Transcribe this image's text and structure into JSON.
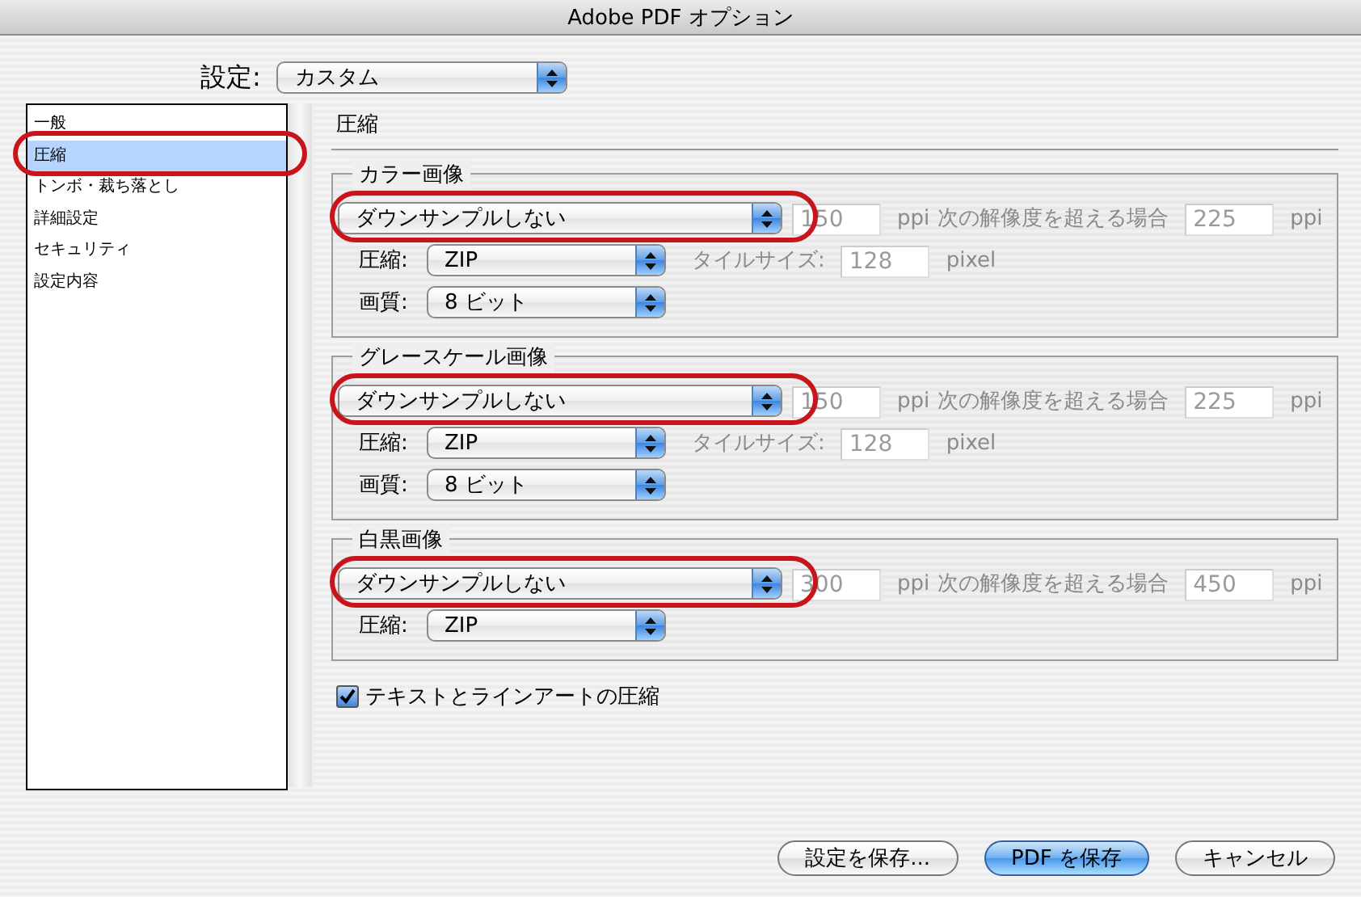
{
  "window": {
    "title": "Adobe PDF オプション"
  },
  "preset": {
    "label": "設定:",
    "value": "カスタム"
  },
  "sidebar": {
    "items": [
      {
        "label": "一般",
        "selected": false,
        "highlighted": false
      },
      {
        "label": "圧縮",
        "selected": true,
        "highlighted": true
      },
      {
        "label": "トンボ・裁ち落とし",
        "selected": false,
        "highlighted": false
      },
      {
        "label": "詳細設定",
        "selected": false,
        "highlighted": false
      },
      {
        "label": "セキュリティ",
        "selected": false,
        "highlighted": false
      },
      {
        "label": "設定内容",
        "selected": false,
        "highlighted": false
      }
    ]
  },
  "panel": {
    "title": "圧縮",
    "groups": [
      {
        "title": "カラー画像",
        "downsample": {
          "value": "ダウンサンプルしない",
          "highlighted": true,
          "disabled": true,
          "resolution": "150",
          "unit": "ppi",
          "threshold_label": "次の解像度を超える場合",
          "threshold": "225",
          "threshold_unit": "ppi"
        },
        "rows": [
          {
            "kind": "tiled",
            "label": "圧縮:",
            "value": "ZIP",
            "tile_label": "タイルサイズ:",
            "tile_value": "128",
            "tile_unit": "pixel",
            "disabled": true
          },
          {
            "kind": "plain",
            "label": "画質:",
            "value": "8 ビット"
          }
        ]
      },
      {
        "title": "グレースケール画像",
        "downsample": {
          "value": "ダウンサンプルしない",
          "highlighted": true,
          "disabled": true,
          "resolution": "150",
          "unit": "ppi",
          "threshold_label": "次の解像度を超える場合",
          "threshold": "225",
          "threshold_unit": "ppi"
        },
        "rows": [
          {
            "kind": "tiled",
            "label": "圧縮:",
            "value": "ZIP",
            "tile_label": "タイルサイズ:",
            "tile_value": "128",
            "tile_unit": "pixel",
            "disabled": true
          },
          {
            "kind": "plain",
            "label": "画質:",
            "value": "8 ビット"
          }
        ]
      },
      {
        "title": "白黒画像",
        "downsample": {
          "value": "ダウンサンプルしない",
          "highlighted": true,
          "disabled": true,
          "resolution": "300",
          "unit": "ppi",
          "threshold_label": "次の解像度を超える場合",
          "threshold": "450",
          "threshold_unit": "ppi"
        },
        "rows": [
          {
            "kind": "plain",
            "label": "圧縮:",
            "value": "ZIP"
          }
        ]
      }
    ],
    "checkbox": {
      "label": "テキストとラインアートの圧縮",
      "checked": true
    }
  },
  "buttons": [
    {
      "label": "設定を保存...",
      "default": false
    },
    {
      "label": "PDF を保存",
      "default": true
    },
    {
      "label": "キャンセル",
      "default": false
    }
  ]
}
